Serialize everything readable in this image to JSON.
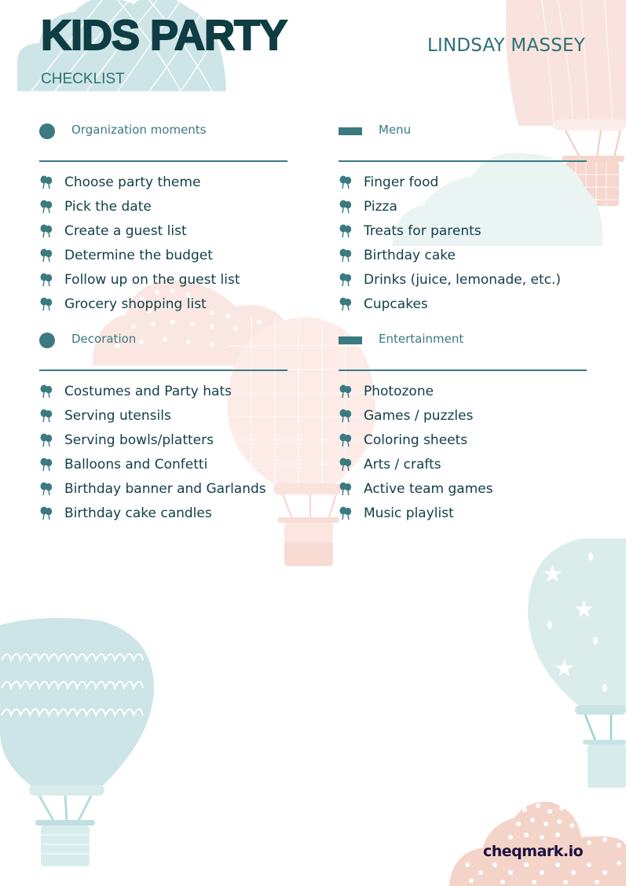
{
  "header": {
    "title": "KIDS PARTY",
    "subtitle": "CHECKLIST",
    "owner_name": "LINDSAY MASSEY"
  },
  "sections": [
    {
      "marker": "circle",
      "title": "Organization moments",
      "items": [
        "Choose party theme",
        "Pick the date",
        "Create a guest list",
        "Determine the budget",
        "Follow up on the guest list",
        "Grocery shopping list"
      ]
    },
    {
      "marker": "bar",
      "title": "Menu",
      "items": [
        "Finger food",
        "Pizza",
        "Treats for parents",
        "Birthday cake",
        "Drinks (juice, lemonade, etc.)",
        "Cupcakes"
      ]
    },
    {
      "marker": "circle",
      "title": "Decoration",
      "items": [
        "Costumes and Party hats",
        "Serving utensils",
        "Serving bowls/platters",
        "Balloons and Confetti",
        "Birthday banner and Garlands",
        "Birthday cake candles"
      ]
    },
    {
      "marker": "bar",
      "title": "Entertainment",
      "items": [
        "Photozone",
        "Games / puzzles",
        "Coloring sheets",
        "Arts / crafts",
        "Active team games",
        "Music playlist"
      ]
    }
  ],
  "bullet_icon": "balloons-icon",
  "footer": {
    "brand": "cheqmark.io"
  },
  "colors": {
    "title": "#0e3d43",
    "accent": "#3a7a80",
    "text": "#103f45",
    "decor_teal": "#cde5e7",
    "decor_pink": "#f6dcd5",
    "brand": "#1b1140"
  }
}
